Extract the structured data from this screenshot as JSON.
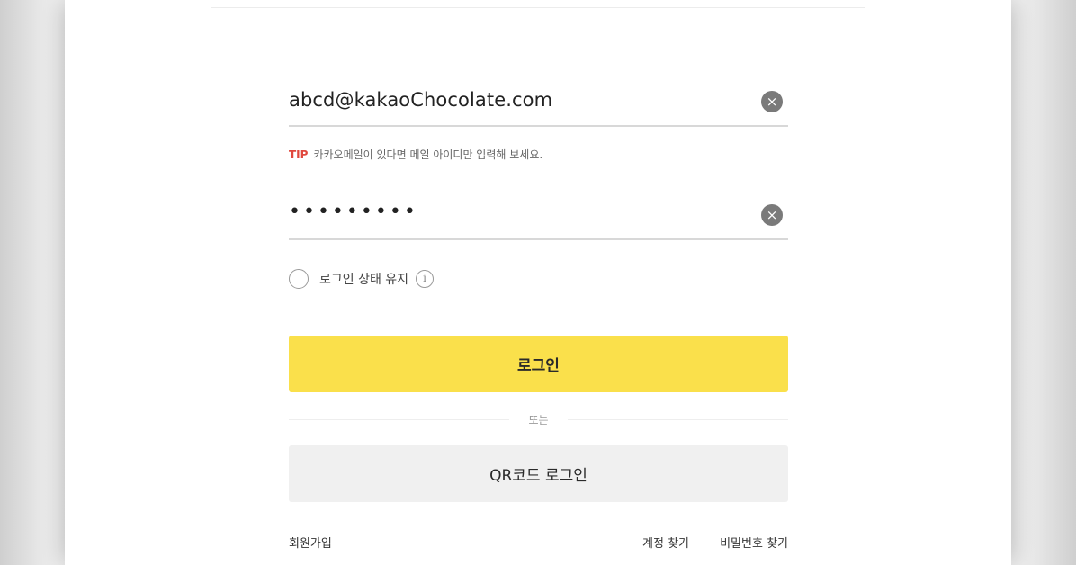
{
  "login_form": {
    "email_value": "abcd@kakaoChocolate.com",
    "password_value": "•••••••••",
    "clear_glyph": "×",
    "tip_label": "TIP",
    "tip_text": "카카오메일이 있다면 메일 아이디만 입력해 보세요.",
    "keep_signed_in_label": "로그인 상태 유지",
    "info_glyph": "i",
    "login_button_label": "로그인",
    "divider_text": "또는",
    "qr_login_button_label": "QR코드 로그인",
    "signup_link": "회원가입",
    "find_account_link": "계정 찾기",
    "find_password_link": "비밀번호 찾기"
  },
  "colors": {
    "login_button_bg": "#fae04b",
    "qr_button_bg": "#f0f0f0",
    "tip_accent": "#e0483e"
  },
  "icons": {
    "email_clear": "clear-circle-x-icon",
    "password_clear": "clear-circle-x-icon",
    "keep_signed_in_info": "info-circle-icon",
    "keep_signed_in_toggle": "radio-circle-icon"
  }
}
